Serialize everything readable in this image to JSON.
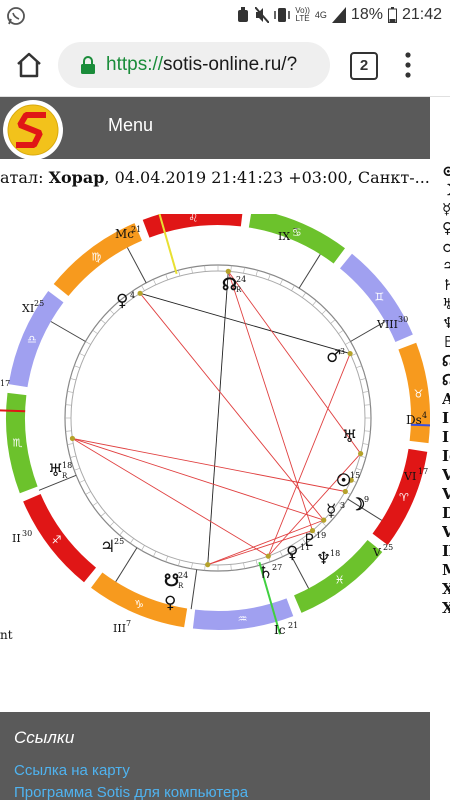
{
  "status_bar": {
    "lte_top": "Vo))",
    "lte_bottom": "LTE",
    "network": "4G",
    "battery": "18%",
    "time": "21:42"
  },
  "browser": {
    "url_scheme": "https://",
    "url_host": "sotis-online.ru/?",
    "tab_count": "2"
  },
  "site": {
    "menu_label": "Menu"
  },
  "chart_header": {
    "prefix": "атал: ",
    "name": "Хорар",
    "details": ", 04.04.2019 21:41:23 +03:00, Санкт-..."
  },
  "left_edge_text": "nt",
  "right_column_glyphs": [
    "⊙",
    "☽",
    "☿",
    "♀",
    "♂",
    "♃",
    "♄",
    "♅",
    "♆",
    "♇",
    "☊",
    "☊",
    "A",
    "I",
    "I",
    "Ic",
    "V",
    "V",
    "D",
    "V",
    "IX",
    "M",
    "X",
    "X"
  ],
  "chart_labels": {
    "mc": "Mc",
    "mc_deg": "21",
    "ic": "Ic",
    "ic_deg": "21",
    "ds": "Ds",
    "ds_deg": "4",
    "houses": [
      {
        "name": "IX",
        "deg": "7"
      },
      {
        "name": "VIII",
        "deg": "30"
      },
      {
        "name": "VI",
        "deg": "17"
      },
      {
        "name": "V",
        "deg": "25"
      },
      {
        "name": "III",
        "deg": "7"
      },
      {
        "name": "II",
        "deg": "30"
      },
      {
        "name": "XI",
        "deg": "25"
      },
      {
        "name": "",
        "deg": "17"
      }
    ],
    "planet_degrees": {
      "node": "24",
      "node_flag": "R",
      "venus": "4",
      "mars": "3",
      "sun": "15",
      "moon": "9",
      "mercury": "3",
      "pluto": "19",
      "venus2": "11",
      "neptune": "18",
      "saturn": "27",
      "jupiter": "25",
      "uranus": "18",
      "uranus_flag": "R",
      "south_node": "24",
      "south_node_flag": "R"
    }
  },
  "footer": {
    "heading": "Ссылки",
    "link1": "Ссылка на карту",
    "link2": "Программа Sotis для компьютера"
  },
  "colors": {
    "fire": "#e01616",
    "earth": "#f79a1e",
    "air": "#a0a0f0",
    "water": "#6cc22c",
    "header": "#5a5a5a",
    "link": "#4fb3f0"
  }
}
